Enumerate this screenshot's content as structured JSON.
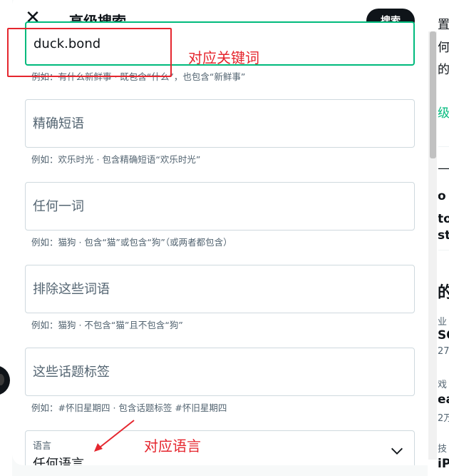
{
  "modal": {
    "title": "高级搜索",
    "close_glyph": "✕",
    "search_button": "搜索"
  },
  "fields": [
    {
      "value": "duck.bond",
      "placeholder": "",
      "hint": "例如：有什么新鲜事 · 既包含“什么”，也包含“新鲜事”"
    },
    {
      "value": "",
      "placeholder": "精确短语",
      "hint": "例如：欢乐时光 · 包含精确短语“欢乐时光”"
    },
    {
      "value": "",
      "placeholder": "任何一词",
      "hint": "例如：猫狗 · 包含“猫”或包含“狗”（或两者都包含）"
    },
    {
      "value": "",
      "placeholder": "排除这些词语",
      "hint": "例如：猫狗 · 不包含“猫”且不包含“狗”"
    },
    {
      "value": "",
      "placeholder": "这些话题标签",
      "hint": "例如：#怀旧星期四 · 包含话题标签 #怀旧星期四"
    }
  ],
  "language": {
    "label": "语言",
    "value": "任何语言",
    "icon": "chevron-down-icon"
  },
  "annotations": {
    "keyword": "对应关键词",
    "language": "对应语言",
    "color": "#e5262e"
  },
  "background": {
    "fragments": [
      "置",
      "何",
      "的",
      "级",
      "o",
      "to",
      "st",
      "的",
      "业",
      "SO",
      "27",
      "戏",
      "ea",
      "2万",
      "技",
      "iPad"
    ]
  },
  "colors": {
    "accent": "#00ba7c",
    "button": "#0f1419",
    "muted": "#536471"
  }
}
